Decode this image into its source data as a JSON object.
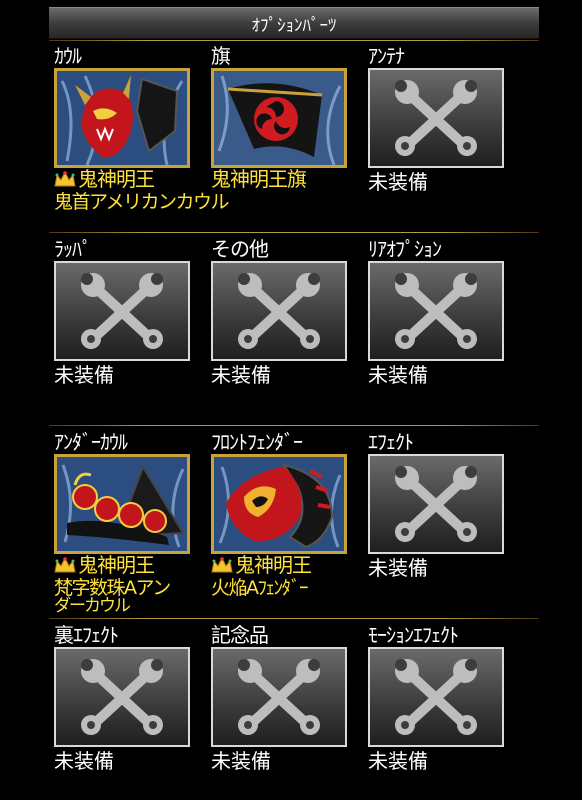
{
  "header": {
    "title": "ｵﾌﾟｼｮﾝﾊﾟｰﾂ"
  },
  "empty_label": "未装備",
  "colors": {
    "name_gold": "#ffe23a",
    "frame_gold": "#c9a23a",
    "divider": "#b89a3c"
  },
  "rows": [
    {
      "slots": [
        {
          "title": "ｶｳﾙ",
          "equipped": true,
          "name": "鬼神明王",
          "sub": "鬼首アメリカンカウル",
          "icon": "crown-icon",
          "art": "demon-mask-cowl"
        },
        {
          "title": "旗",
          "equipped": true,
          "name": "鬼神明王旗",
          "sub": "",
          "icon": "",
          "art": "tomoe-flag"
        },
        {
          "title": "ｱﾝﾃﾅ",
          "equipped": false,
          "icon": "wrench-cross-icon"
        }
      ]
    },
    {
      "slots": [
        {
          "title": "ﾗｯﾊﾟ",
          "equipped": false,
          "icon": "wrench-cross-icon"
        },
        {
          "title": "その他",
          "equipped": false,
          "icon": "wrench-cross-icon"
        },
        {
          "title": "ﾘｱｵﾌﾟｼｮﾝ",
          "equipped": false,
          "icon": "wrench-cross-icon"
        }
      ]
    },
    {
      "slots": [
        {
          "title": "ｱﾝﾀﾞｰｶｳﾙ",
          "equipped": true,
          "name": "鬼神明王",
          "sub": "梵字数珠Aアン",
          "sub2": "ダーカウル",
          "icon": "crown-icon",
          "art": "prayer-bead-undercowl"
        },
        {
          "title": "ﾌﾛﾝﾄﾌｪﾝﾀﾞｰ",
          "equipped": true,
          "name": "鬼神明王",
          "sub": "火焔Aﾌｪﾝﾀﾞｰ",
          "icon": "crown-icon",
          "art": "flame-fender"
        },
        {
          "title": "ｴﾌｪｸﾄ",
          "equipped": false,
          "icon": "wrench-cross-icon"
        }
      ]
    },
    {
      "slots": [
        {
          "title": "裏ｴﾌｪｸﾄ",
          "equipped": false,
          "icon": "wrench-cross-icon"
        },
        {
          "title": "記念品",
          "equipped": false,
          "icon": "wrench-cross-icon"
        },
        {
          "title": "ﾓｰｼｮﾝｴﾌｪｸﾄ",
          "equipped": false,
          "icon": "wrench-cross-icon"
        }
      ]
    }
  ]
}
